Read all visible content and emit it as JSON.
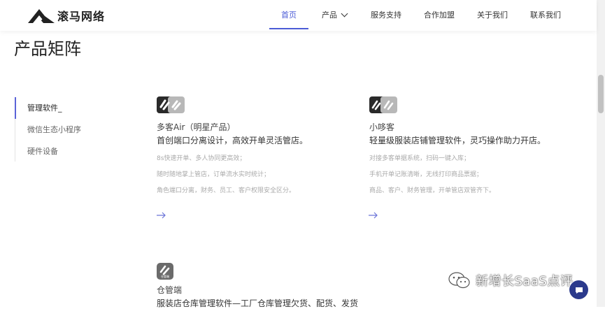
{
  "header": {
    "brand": "滚马网络",
    "nav": [
      {
        "label": "首页",
        "active": true
      },
      {
        "label": "产品",
        "has_dropdown": true
      },
      {
        "label": "服务支持"
      },
      {
        "label": "合作加盟"
      },
      {
        "label": "关于我们"
      },
      {
        "label": "联系我们"
      }
    ]
  },
  "page": {
    "title": "产品矩阵"
  },
  "sidebar": {
    "items": [
      {
        "label": "管理软件_",
        "active": true
      },
      {
        "label": "微信生态小程序"
      },
      {
        "label": "硬件设备"
      }
    ]
  },
  "products": [
    {
      "name": "多客Air（明星产品）",
      "desc": "首创端口分离设计，高效开单灵活管店。",
      "features": [
        "8s快速开单、多人协同更高效；",
        "随时随地掌上管店，订单流水实时统计；",
        "角色端口分离，财务、员工、客户权限安全区分。"
      ]
    },
    {
      "name": "小哆客",
      "desc": "轻量级服装店铺管理软件，灵巧操作助力开店。",
      "features": [
        "对接多客单据系统，扫码一键入库；",
        "手机开单记账清晰，无线打印商品票据；",
        "商品、客户、财务管理，开单管店双管齐下。"
      ]
    },
    {
      "name": "仓管端",
      "logo_caption": "仓管端",
      "desc": "服装店仓库管理软件—工厂仓库管理欠货、配货、发货",
      "features": []
    }
  ],
  "watermark": {
    "text": "新增长SaaS点评"
  },
  "colors": {
    "accent": "#4b5bd6",
    "sidebar_active": "#5b63d8",
    "chat_button": "#2b3a8c"
  }
}
